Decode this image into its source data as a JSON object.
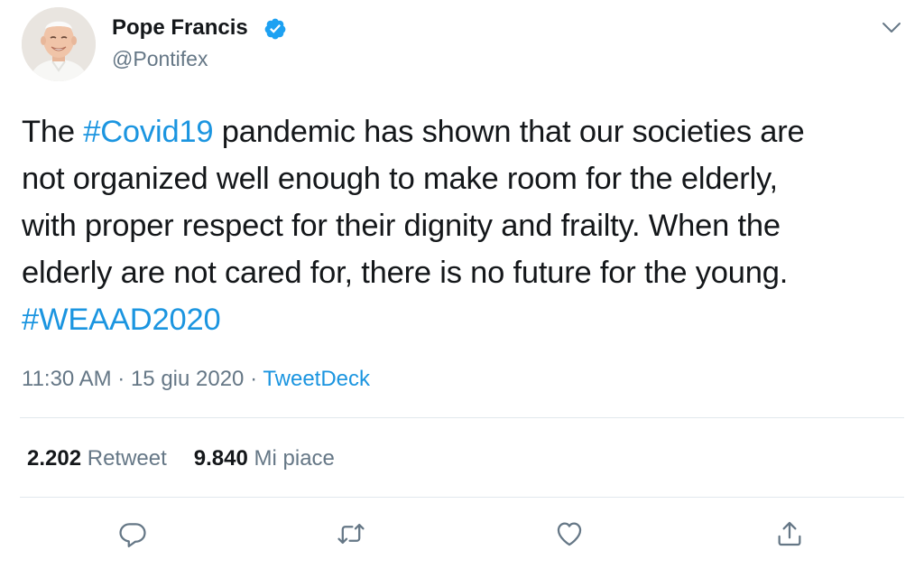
{
  "user": {
    "display_name": "Pope Francis",
    "handle": "@Pontifex"
  },
  "tweet": {
    "lines": [
      [
        {
          "text": "The ",
          "hashtag": false
        },
        {
          "text": "#Covid19",
          "hashtag": true
        },
        {
          "text": " pandemic has shown that our societies are",
          "hashtag": false
        }
      ],
      [
        {
          "text": "not organized well enough to make room for the elderly,",
          "hashtag": false
        }
      ],
      [
        {
          "text": "with proper respect for their dignity and frailty. When the",
          "hashtag": false
        }
      ],
      [
        {
          "text": "elderly are not cared for, there is no future for the young.",
          "hashtag": false
        }
      ],
      [
        {
          "text": "#WEAAD2020",
          "hashtag": true
        }
      ]
    ],
    "time": "11:30 AM",
    "separator": " · ",
    "date": "15 giu 2020",
    "source": "TweetDeck"
  },
  "stats": {
    "retweets_count": "2.202",
    "retweets_label": "Retweet",
    "likes_count": "9.840",
    "likes_label": "Mi piace"
  },
  "icons": {
    "verified": "verified-badge-icon",
    "caret": "chevron-down-icon",
    "reply": "reply-icon",
    "retweet": "retweet-icon",
    "like": "heart-icon",
    "share": "share-icon"
  },
  "colors": {
    "link": "#1b95e0",
    "text": "#14171a",
    "secondary": "#657786",
    "divider": "#e1e8ed",
    "icon": "#657786"
  }
}
